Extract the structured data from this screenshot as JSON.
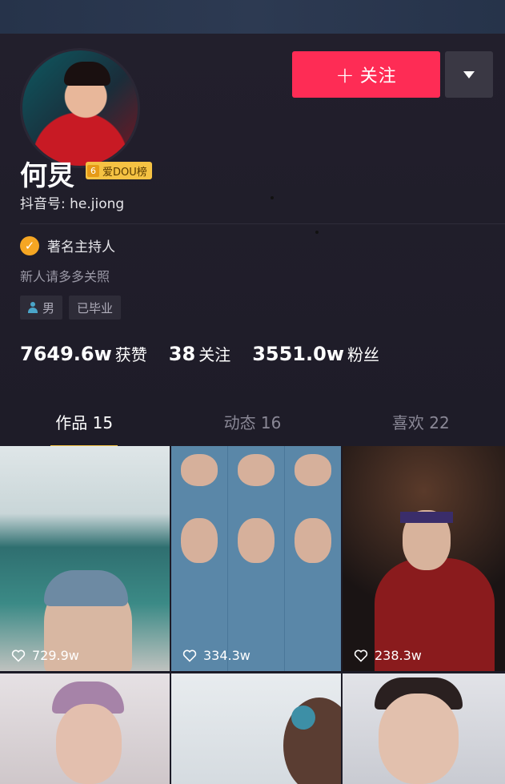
{
  "profile": {
    "name": "何炅",
    "badge_level": "6",
    "badge_text": "爱DOU榜",
    "douyin_id": "抖音号: he.jiong",
    "verification": "著名主持人",
    "bio": "新人请多多关照",
    "tags": [
      "男",
      "已毕业"
    ]
  },
  "actions": {
    "follow_icon": "+",
    "follow_label": "关注",
    "dropdown_icon": "triangle-down-icon"
  },
  "stats": [
    {
      "value": "7649.6w",
      "label": "获赞"
    },
    {
      "value": "38",
      "label": "关注"
    },
    {
      "value": "3551.0w",
      "label": "粉丝"
    }
  ],
  "tabs": [
    {
      "label": "作品 15",
      "active": true
    },
    {
      "label": "动态 16",
      "active": false
    },
    {
      "label": "喜欢 22",
      "active": false
    }
  ],
  "videos": [
    {
      "likes": "729.9w"
    },
    {
      "likes": "334.3w"
    },
    {
      "likes": "238.3w"
    },
    {
      "likes": ""
    },
    {
      "likes": ""
    },
    {
      "likes": ""
    }
  ],
  "colors": {
    "follow_button": "#fe2c55",
    "badge": "#f5c243",
    "verify_check": "#f5a623",
    "background": "#1c1b27"
  }
}
